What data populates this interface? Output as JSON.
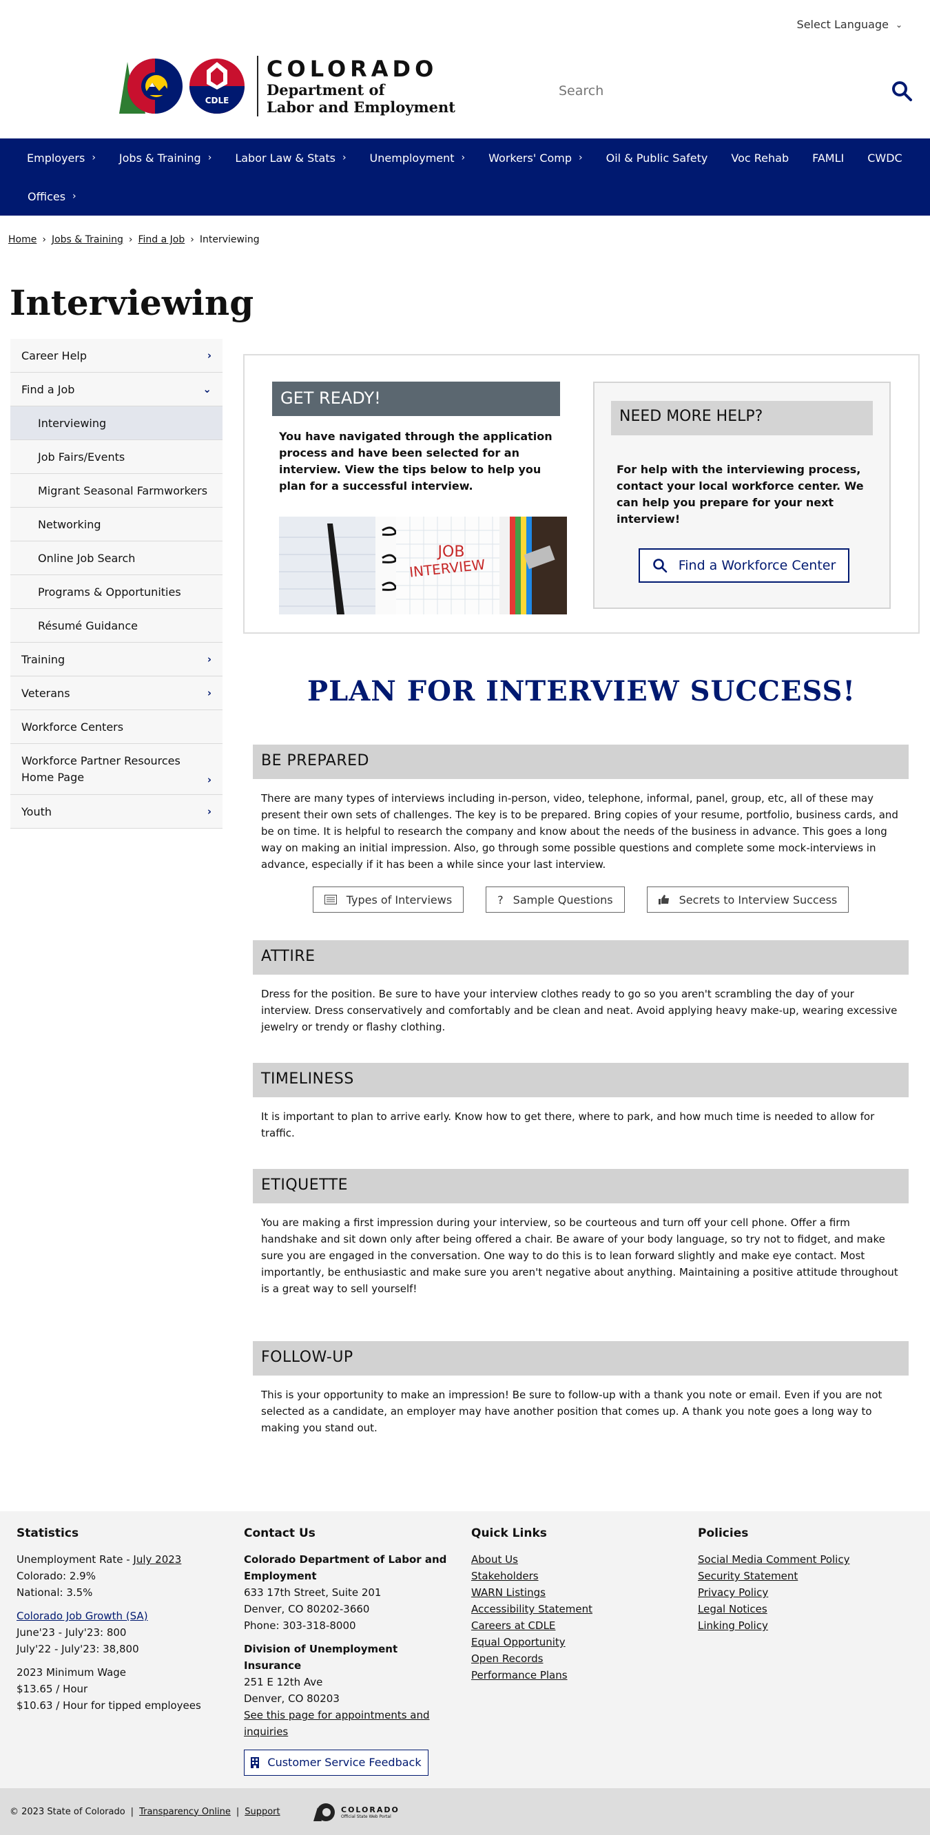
{
  "top": {
    "language": "Select Language"
  },
  "logo": {
    "state": "COLORADO",
    "dept_line1": "Department of",
    "dept_line2": "Labor and Employment",
    "badge": "CDLE"
  },
  "search": {
    "placeholder": "Search"
  },
  "nav": {
    "row1": [
      "Employers",
      "Jobs & Training",
      "Labor Law & Stats",
      "Unemployment",
      "Workers' Comp",
      "Oil & Public Safety",
      "Voc Rehab",
      "FAMLI",
      "CWDC"
    ],
    "row1_has_chevron": [
      true,
      true,
      true,
      true,
      true,
      false,
      false,
      false,
      false
    ],
    "row2": [
      "Offices"
    ]
  },
  "breadcrumb": [
    "Home",
    "Jobs & Training",
    "Find a Job",
    "Interviewing"
  ],
  "page_title": "Interviewing",
  "sidebar": [
    {
      "label": "Career Help",
      "chevron": "right"
    },
    {
      "label": "Find a Job",
      "chevron": "down"
    },
    {
      "label": "Interviewing",
      "sub": true,
      "active": true
    },
    {
      "label": "Job Fairs/Events",
      "sub": true
    },
    {
      "label": "Migrant Seasonal Farmworkers",
      "sub": true
    },
    {
      "label": "Networking",
      "sub": true
    },
    {
      "label": "Online Job Search",
      "sub": true
    },
    {
      "label": "Programs & Opportunities",
      "sub": true
    },
    {
      "label": "Résumé Guidance",
      "sub": true
    },
    {
      "label": "Training",
      "chevron": "right"
    },
    {
      "label": "Veterans",
      "chevron": "right"
    },
    {
      "label": "Workforce Centers"
    },
    {
      "label": "Workforce Partner Resources Home Page",
      "chevron": "right",
      "tall": true
    },
    {
      "label": "Youth",
      "chevron": "right"
    }
  ],
  "ready": {
    "heading": "GET READY!",
    "text": "You have navigated through the application process and have been selected for an interview. View the tips below to help you plan for a successful interview.",
    "image_label_1": "JOB",
    "image_label_2": "INTERVIEW"
  },
  "help": {
    "heading": "NEED MORE HELP?",
    "text": "For help with the interviewing process, contact your local workforce center. We can help you prepare for your next interview!",
    "button": "Find a Workforce Center"
  },
  "plan_title": "PLAN FOR INTERVIEW SUCCESS!",
  "sections": {
    "prepared": {
      "heading": "BE PREPARED",
      "body": "There are many types of interviews including in-person, video, telephone, informal, panel, group, etc, all of these may present their own sets of challenges. The key is to be prepared. Bring copies of your resume, portfolio, business cards, and be on time. It is helpful to research the company and know about the needs of the business in advance. This goes a long way on making an initial impression. Also, go through some possible questions and complete some mock-interviews in advance, especially if it has been a while since your last interview.",
      "buttons": [
        "Types of Interviews",
        "Sample Questions",
        "Secrets to Interview Success"
      ]
    },
    "attire": {
      "heading": "ATTIRE",
      "body": "Dress for the position. Be sure to have your interview clothes ready to go so you aren't scrambling the day of your interview. Dress conservatively and comfortably and be clean and neat. Avoid applying heavy make-up, wearing excessive jewelry or trendy or flashy clothing."
    },
    "timeliness": {
      "heading": "TIMELINESS",
      "body": "It is important to plan to arrive early. Know how to get there, where to park, and how much time is needed to allow for traffic."
    },
    "etiquette": {
      "heading": "ETIQUETTE",
      "body": "You are making a first impression during your interview, so be courteous and turn off your cell phone. Offer a firm handshake and sit down only after being offered a chair. Be aware of your body language, so try not to fidget, and make sure you are engaged in the conversation. One way to do this is to lean forward slightly and make eye contact. Most importantly, be enthusiastic and make sure you aren't negative about anything. Maintaining a positive attitude throughout is a great way to sell yourself!"
    },
    "followup": {
      "heading": "FOLLOW-UP",
      "body": "This is your opportunity to make an impression! Be sure to follow-up with a thank you note or email. Even if you are not selected as a candidate, an employer may have another position that comes up. A thank you note goes a long way to making you stand out."
    }
  },
  "footer": {
    "statistics": {
      "heading": "Statistics",
      "unemp_prefix": "Unemployment Rate - ",
      "unemp_link": "July 2023",
      "colorado": "Colorado: 2.9%",
      "national": "National: 3.5%",
      "growth_link": "Colorado Job Growth (SA)",
      "growth1": "June'23 - July'23: 800",
      "growth2": "July'22 - July'23: 38,800",
      "min_wage_head": "2023 Minimum Wage",
      "min_wage1": "$13.65 / Hour",
      "min_wage2": "$10.63 / Hour for tipped employees"
    },
    "contact": {
      "heading": "Contact Us",
      "org1": "Colorado Department of Labor and Employment",
      "addr1": "633 17th Street, Suite 201",
      "city1": "Denver, CO  80202-3660",
      "phone1": "Phone: 303-318-8000",
      "org2": "Division of Unemployment Insurance",
      "addr2": "251 E 12th Ave",
      "city2": "Denver, CO  80203",
      "appt_link": "See this page for appointments and inquiries",
      "feedback": "Customer Service Feedback"
    },
    "quick_links": {
      "heading": "Quick Links",
      "links": [
        "About Us",
        "Stakeholders",
        "WARN Listings",
        "Accessibility Statement",
        "Careers at CDLE",
        "Equal Opportunity",
        "Open Records",
        "Performance Plans"
      ]
    },
    "policies": {
      "heading": "Policies",
      "links": [
        "Social Media Comment Policy",
        "Security Statement",
        "Privacy Policy",
        "Legal Notices",
        "Linking Policy"
      ]
    }
  },
  "bottom": {
    "copyright": "© 2023 State of Colorado",
    "transparency": "Transparency Online",
    "support": "Support",
    "portal_name": "COLORADO",
    "portal_sub": "Official State Web Portal"
  },
  "colors": {
    "nav": "#001970",
    "accent": "#001970",
    "section_head": "#d2d2d2",
    "ready_head": "#5b6770"
  }
}
